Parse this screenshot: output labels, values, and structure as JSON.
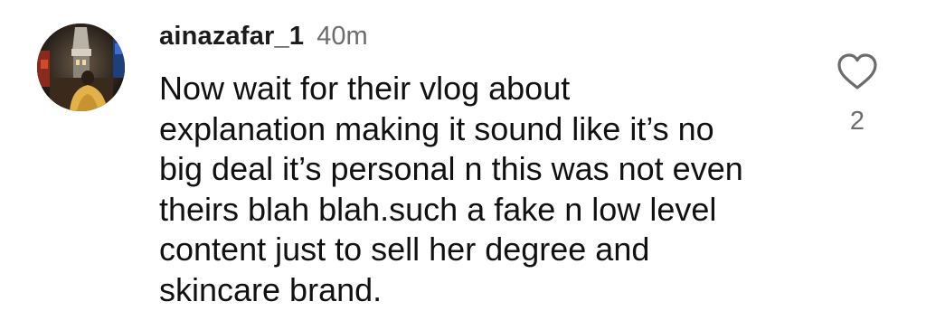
{
  "comment": {
    "username": "ainazafar_1",
    "timestamp": "40m",
    "text_lines": [
      "Now wait for their vlog about",
      "explanation making it sound like it’s no",
      "big deal it’s personal n this was not even",
      "theirs blah blah.such a fake n low level",
      "content just to sell her degree and",
      "skincare brand."
    ],
    "like_count": "2",
    "like_icon": "heart-outline-icon"
  }
}
